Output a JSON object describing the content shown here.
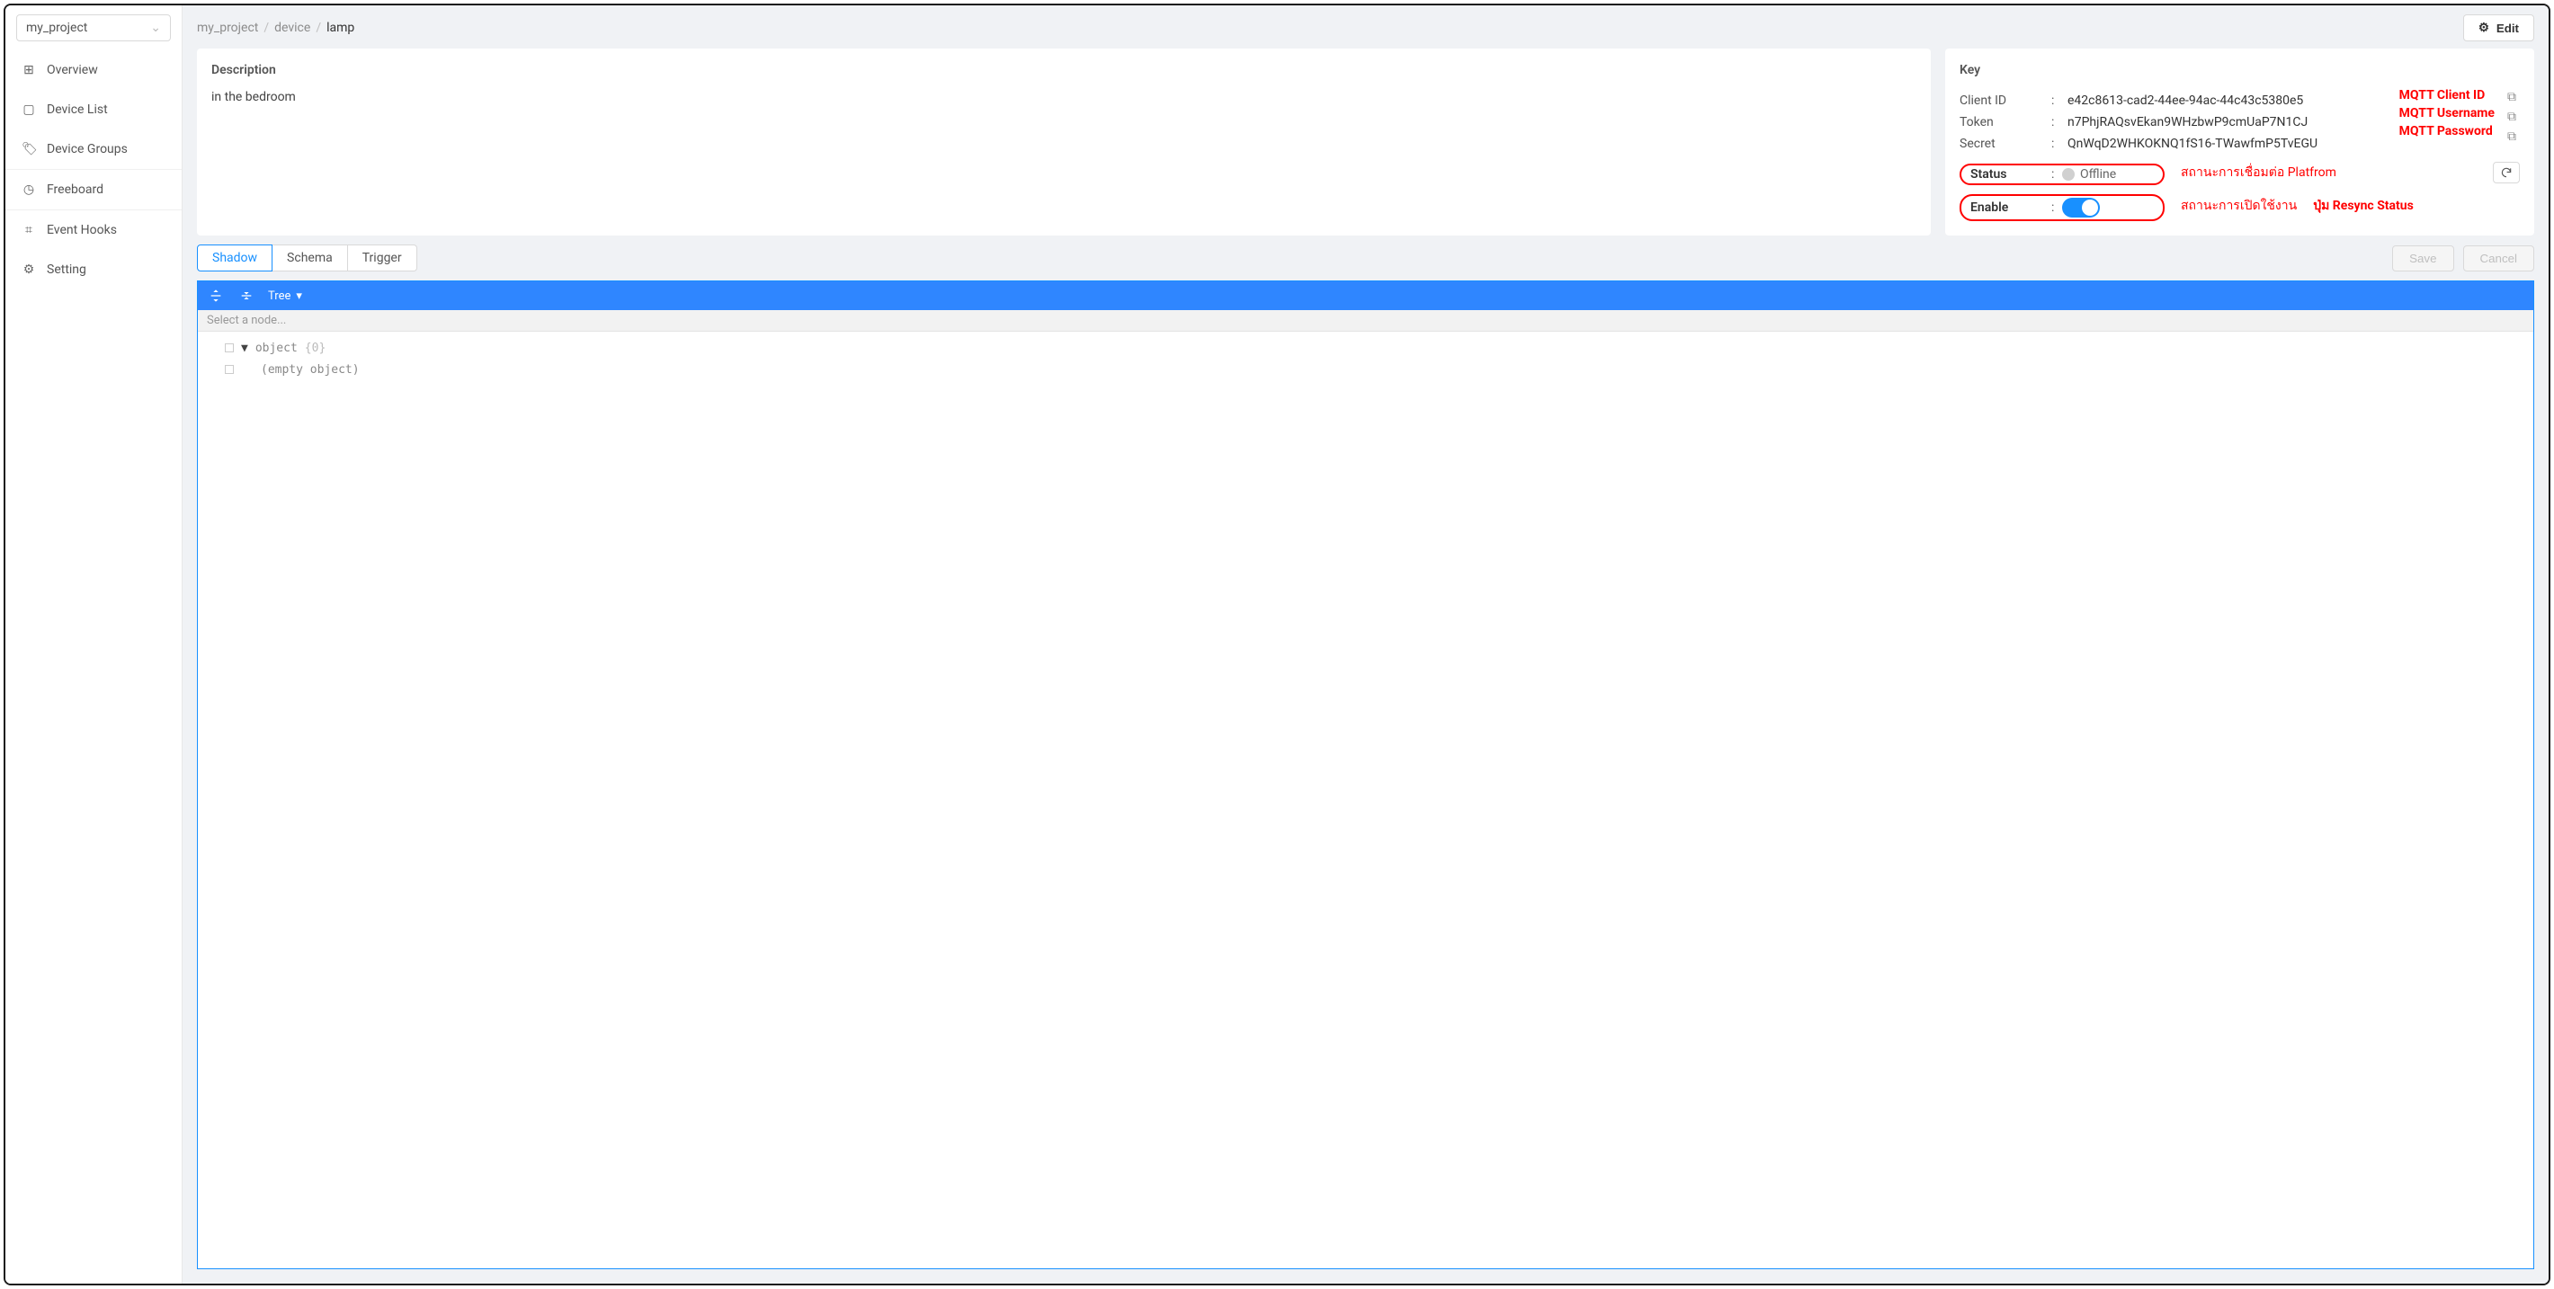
{
  "sidebar": {
    "project": "my_project",
    "items": [
      {
        "label": "Overview"
      },
      {
        "label": "Device List"
      },
      {
        "label": "Device Groups"
      },
      {
        "label": "Freeboard"
      },
      {
        "label": "Event Hooks"
      },
      {
        "label": "Setting"
      }
    ]
  },
  "breadcrumb": {
    "parts": [
      "my_project",
      "device",
      "lamp"
    ]
  },
  "header": {
    "edit_label": "Edit"
  },
  "description": {
    "title": "Description",
    "text": "in the bedroom"
  },
  "key": {
    "title": "Key",
    "rows": [
      {
        "label": "Client ID",
        "value": "e42c8613-cad2-44ee-94ac-44c43c5380e5",
        "annot": "MQTT Client ID"
      },
      {
        "label": "Token",
        "value": "n7PhjRAQsvEkan9WHzbwP9cmUaP7N1CJ",
        "annot": "MQTT Username"
      },
      {
        "label": "Secret",
        "value": "QnWqD2WHKOKNQ1fS16-TWawfmP5TvEGU",
        "annot": "MQTT Password"
      }
    ],
    "status_label": "Status",
    "status_value": "Offline",
    "status_annot": "สถานะการเชื่อมต่อ Platfrom",
    "enable_label": "Enable",
    "enable_annot": "สถานะการเปิดใช้งาน",
    "resync_annot": "ปุ่ม Resync Status"
  },
  "tabs": {
    "items": [
      "Shadow",
      "Schema",
      "Trigger"
    ],
    "save_label": "Save",
    "cancel_label": "Cancel"
  },
  "editor": {
    "view_mode": "Tree",
    "select_placeholder": "Select a node...",
    "root_type": "object",
    "root_meta": "{0}",
    "empty_text": "(empty object)"
  }
}
